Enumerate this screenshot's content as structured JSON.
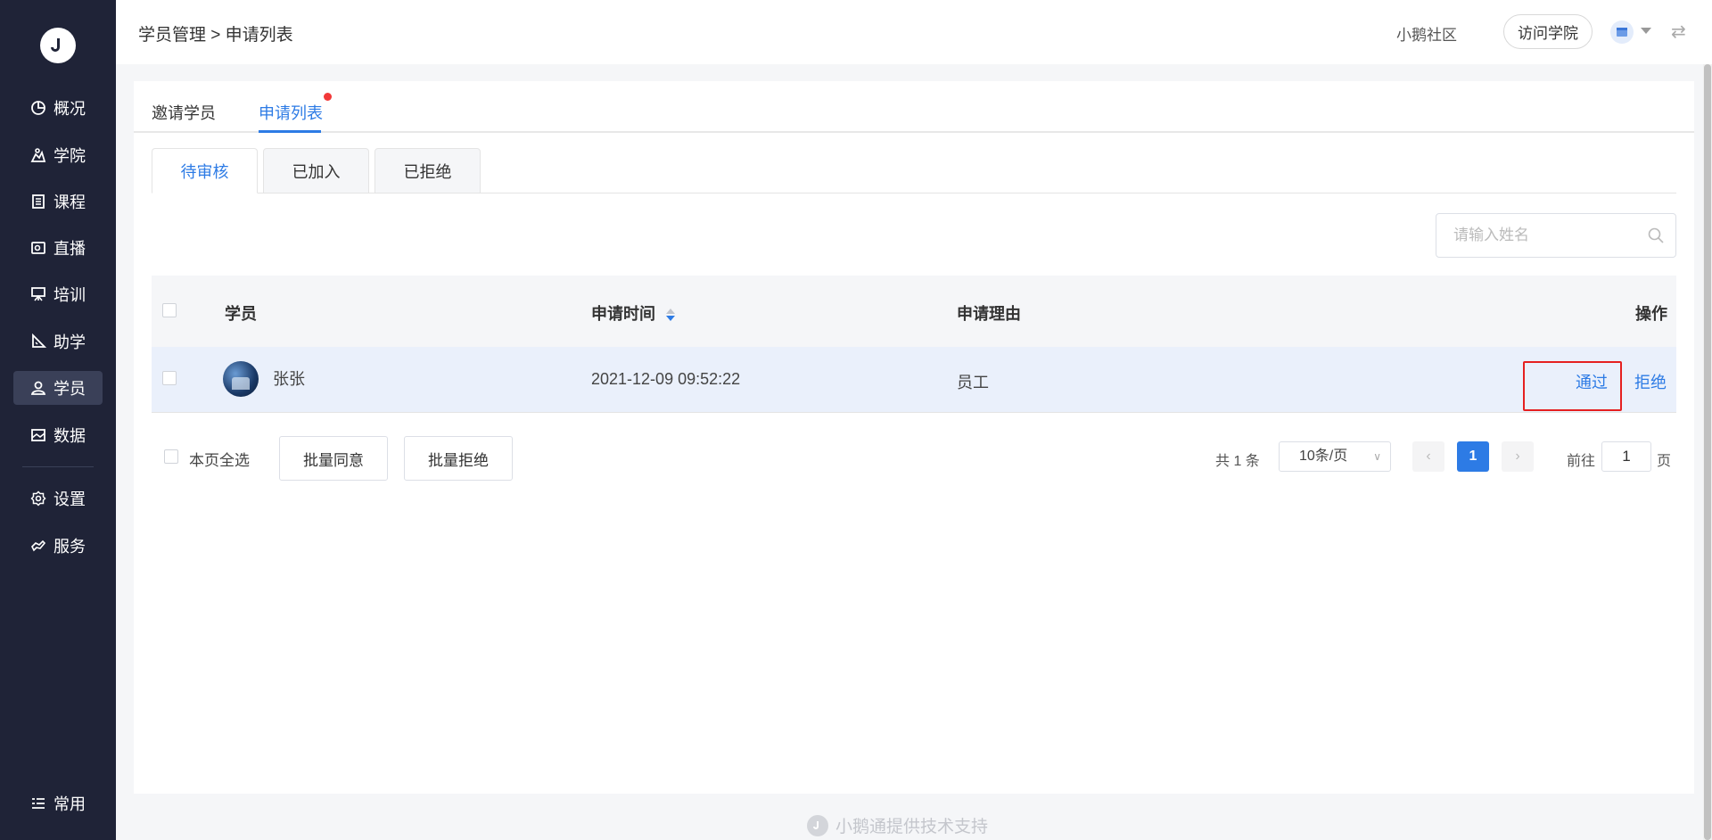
{
  "sidebar": {
    "items": [
      {
        "label": "概况",
        "icon": "pie-chart-icon"
      },
      {
        "label": "学院",
        "icon": "academy-icon"
      },
      {
        "label": "课程",
        "icon": "document-icon"
      },
      {
        "label": "直播",
        "icon": "live-camera-icon"
      },
      {
        "label": "培训",
        "icon": "training-board-icon"
      },
      {
        "label": "助学",
        "icon": "ruler-icon"
      },
      {
        "label": "学员",
        "icon": "user-icon"
      },
      {
        "label": "数据",
        "icon": "picture-icon"
      },
      {
        "label": "设置",
        "icon": "gear-icon"
      },
      {
        "label": "服务",
        "icon": "handshake-icon"
      },
      {
        "label": "常用",
        "icon": "list-icon"
      }
    ],
    "active": "学员"
  },
  "header": {
    "breadcrumb": "学员管理 > 申请列表",
    "community": "小鹅社区",
    "visit_button": "访问学院"
  },
  "tabs": [
    {
      "label": "邀请学员"
    },
    {
      "label": "申请列表"
    }
  ],
  "subtabs": [
    {
      "label": "待审核"
    },
    {
      "label": "已加入"
    },
    {
      "label": "已拒绝"
    }
  ],
  "search": {
    "placeholder": "请输入姓名"
  },
  "table": {
    "columns": {
      "student": "学员",
      "time": "申请时间",
      "reason": "申请理由",
      "actions": "操作"
    },
    "rows": [
      {
        "name": "张张",
        "time": "2021-12-09 09:52:22",
        "reason": "员工",
        "approve": "通过",
        "reject": "拒绝"
      }
    ]
  },
  "bulk": {
    "select_all": "本页全选",
    "approve": "批量同意",
    "reject": "批量拒绝"
  },
  "pagination": {
    "total": "共 1 条",
    "page_size": "10条/页",
    "current": "1",
    "goto_label": "前往",
    "goto_value": "1",
    "page_suffix": "页"
  },
  "footer": "小鹅通提供技术支持",
  "colors": {
    "accent": "#2d7be5",
    "sidebar": "#1f2337",
    "highlight": "#e52020"
  }
}
